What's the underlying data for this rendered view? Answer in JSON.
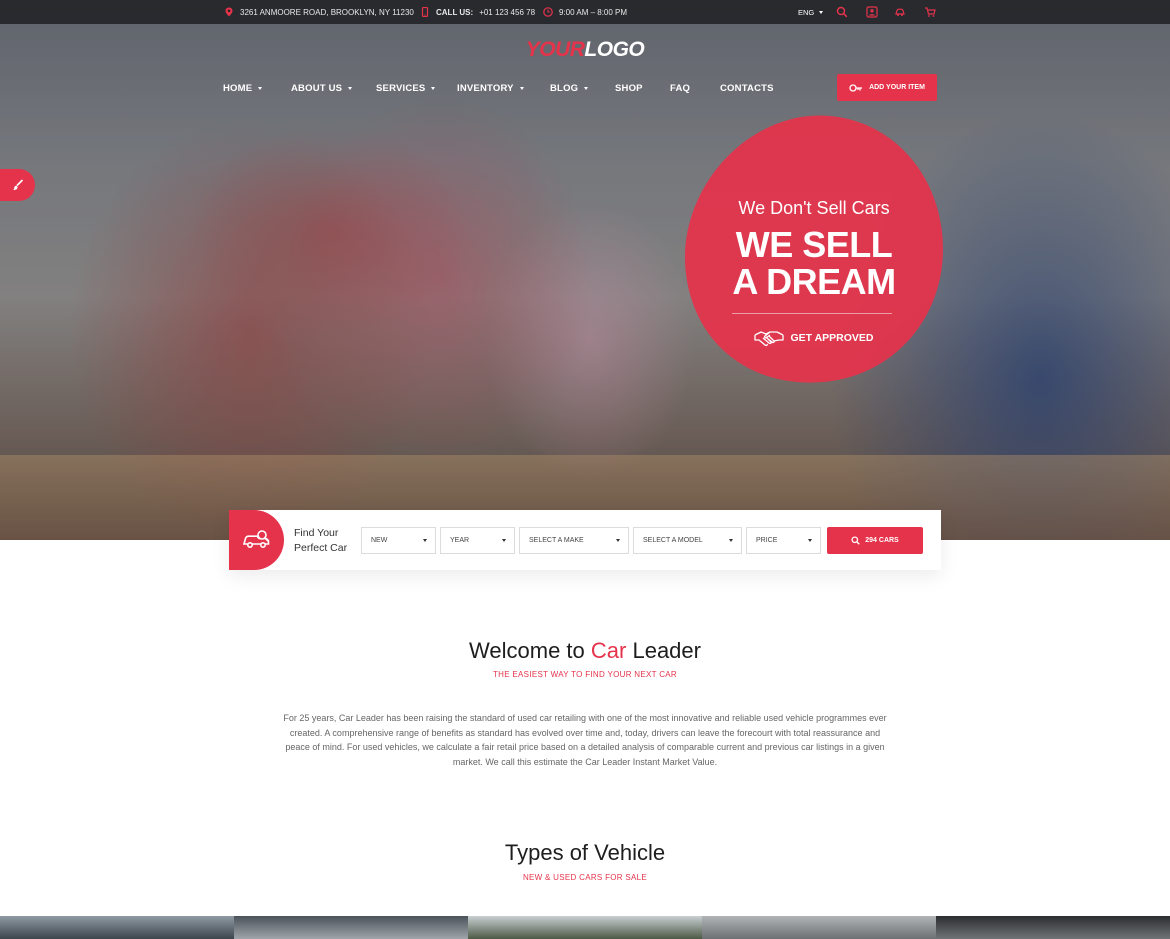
{
  "topbar": {
    "address": "3261 ANMOORE ROAD, BROOKLYN, NY 11230",
    "call_label": "CALL US:",
    "phone": "+01 123 456 78",
    "hours": "9:00 AM – 8:00 PM",
    "language": "ENG"
  },
  "logo": {
    "part1": "YOUR",
    "part2": "LOGO"
  },
  "nav": {
    "items": [
      {
        "label": "HOME"
      },
      {
        "label": "ABOUT US"
      },
      {
        "label": "SERVICES"
      },
      {
        "label": "INVENTORY"
      },
      {
        "label": "BLOG"
      },
      {
        "label": "SHOP"
      },
      {
        "label": "FAQ"
      },
      {
        "label": "CONTACTS"
      }
    ],
    "add_item_label": "ADD YOUR ITEM"
  },
  "hero": {
    "line1": "We Don't Sell Cars",
    "line2": "WE SELL",
    "line3": "A DREAM",
    "cta_label": "GET APPROVED"
  },
  "search": {
    "title_line1": "Find Your",
    "title_line2": "Perfect Car",
    "condition": "NEW",
    "year": "YEAR",
    "make": "SELECT A MAKE",
    "model": "SELECT A MODEL",
    "price": "PRICE",
    "button_label": "294 CARS"
  },
  "welcome": {
    "title_pre": "Welcome to",
    "title_accent": "Car",
    "title_post": "Leader",
    "subtitle": "THE EASIEST WAY TO FIND YOUR NEXT CAR",
    "body": "For 25 years, Car Leader has been raising the standard of used car retailing with one of the most innovative and reliable used vehicle programmes ever created. A comprehensive range of benefits as standard has evolved over time and, today, drivers can leave the forecourt with total reassurance and peace of mind. For used vehicles, we calculate a fair retail price based on a detailed analysis of comparable current and previous car listings in a given market. We call this estimate the Car Leader Instant Market Value."
  },
  "types": {
    "title": "Types of Vehicle",
    "subtitle": "NEW & USED CARS FOR SALE"
  },
  "colors": {
    "accent": "#e5334b",
    "topbar_bg": "#19191e",
    "text_dark": "#1e1e1e",
    "text_body": "#666666"
  }
}
